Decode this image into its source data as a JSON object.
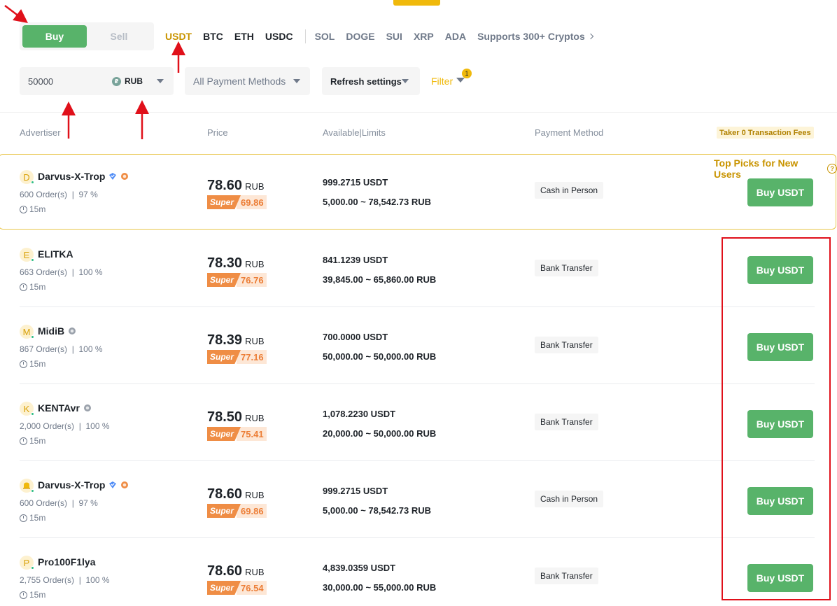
{
  "trade_side": {
    "buy_label": "Buy",
    "sell_label": "Sell"
  },
  "crypto_tabs": {
    "primary": [
      "USDT",
      "BTC",
      "ETH",
      "USDC"
    ],
    "secondary": [
      "SOL",
      "DOGE",
      "SUI",
      "XRP",
      "ADA"
    ],
    "active": "USDT",
    "supports_label": "Supports 300+ Cryptos"
  },
  "filters": {
    "amount_value": "50000",
    "currency_icon": "₽",
    "currency": "RUB",
    "payment_methods": "All Payment Methods",
    "refresh": "Refresh settings",
    "filter_label": "Filter",
    "filter_count": "1"
  },
  "columns": {
    "advertiser": "Advertiser",
    "price": "Price",
    "available_limits": "Available|Limits",
    "payment_method": "Payment Method",
    "taker_fees": "Taker 0 Transaction Fees"
  },
  "top_picks_label": "Top Picks for New Users",
  "ads": [
    {
      "avatar": "D",
      "name": "Darvus-X-Trop",
      "orders": "600 Order(s)  |  97 %",
      "time": "15m",
      "price": "78.60",
      "price_currency": "RUB",
      "super_label": "Super",
      "super_price": "69.86",
      "available": "999.2715 USDT",
      "limits": "5,000.00 ~ 78,542.73 RUB",
      "payment": "Cash in Person",
      "button": "Buy USDT"
    },
    {
      "avatar": "E",
      "name": "ELITKA",
      "orders": "663 Order(s)  |  100 %",
      "time": "15m",
      "price": "78.30",
      "price_currency": "RUB",
      "super_label": "Super",
      "super_price": "76.76",
      "available": "841.1239 USDT",
      "limits": "39,845.00 ~ 65,860.00 RUB",
      "payment": "Bank Transfer",
      "button": "Buy USDT"
    },
    {
      "avatar": "M",
      "name": "MidiB",
      "orders": "867 Order(s)  |  100 %",
      "time": "15m",
      "price": "78.39",
      "price_currency": "RUB",
      "super_label": "Super",
      "super_price": "77.16",
      "available": "700.0000 USDT",
      "limits": "50,000.00 ~ 50,000.00 RUB",
      "payment": "Bank Transfer",
      "button": "Buy USDT"
    },
    {
      "avatar": "K",
      "name": "KENTAvr",
      "orders": "2,000 Order(s)  |  100 %",
      "time": "15m",
      "price": "78.50",
      "price_currency": "RUB",
      "super_label": "Super",
      "super_price": "75.41",
      "available": "1,078.2230 USDT",
      "limits": "20,000.00 ~ 50,000.00 RUB",
      "payment": "Bank Transfer",
      "button": "Buy USDT"
    },
    {
      "avatar": "",
      "name": "Darvus-X-Trop",
      "orders": "600 Order(s)  |  97 %",
      "time": "15m",
      "price": "78.60",
      "price_currency": "RUB",
      "super_label": "Super",
      "super_price": "69.86",
      "available": "999.2715 USDT",
      "limits": "5,000.00 ~ 78,542.73 RUB",
      "payment": "Cash in Person",
      "button": "Buy USDT"
    },
    {
      "avatar": "P",
      "name": "Pro100F1lya",
      "orders": "2,755 Order(s)  |  100 %",
      "time": "15m",
      "price": "78.60",
      "price_currency": "RUB",
      "super_label": "Super",
      "super_price": "76.54",
      "available": "4,839.0359 USDT",
      "limits": "30,000.00 ~ 55,000.00 RUB",
      "payment": "Bank Transfer",
      "button": "Buy USDT"
    }
  ]
}
